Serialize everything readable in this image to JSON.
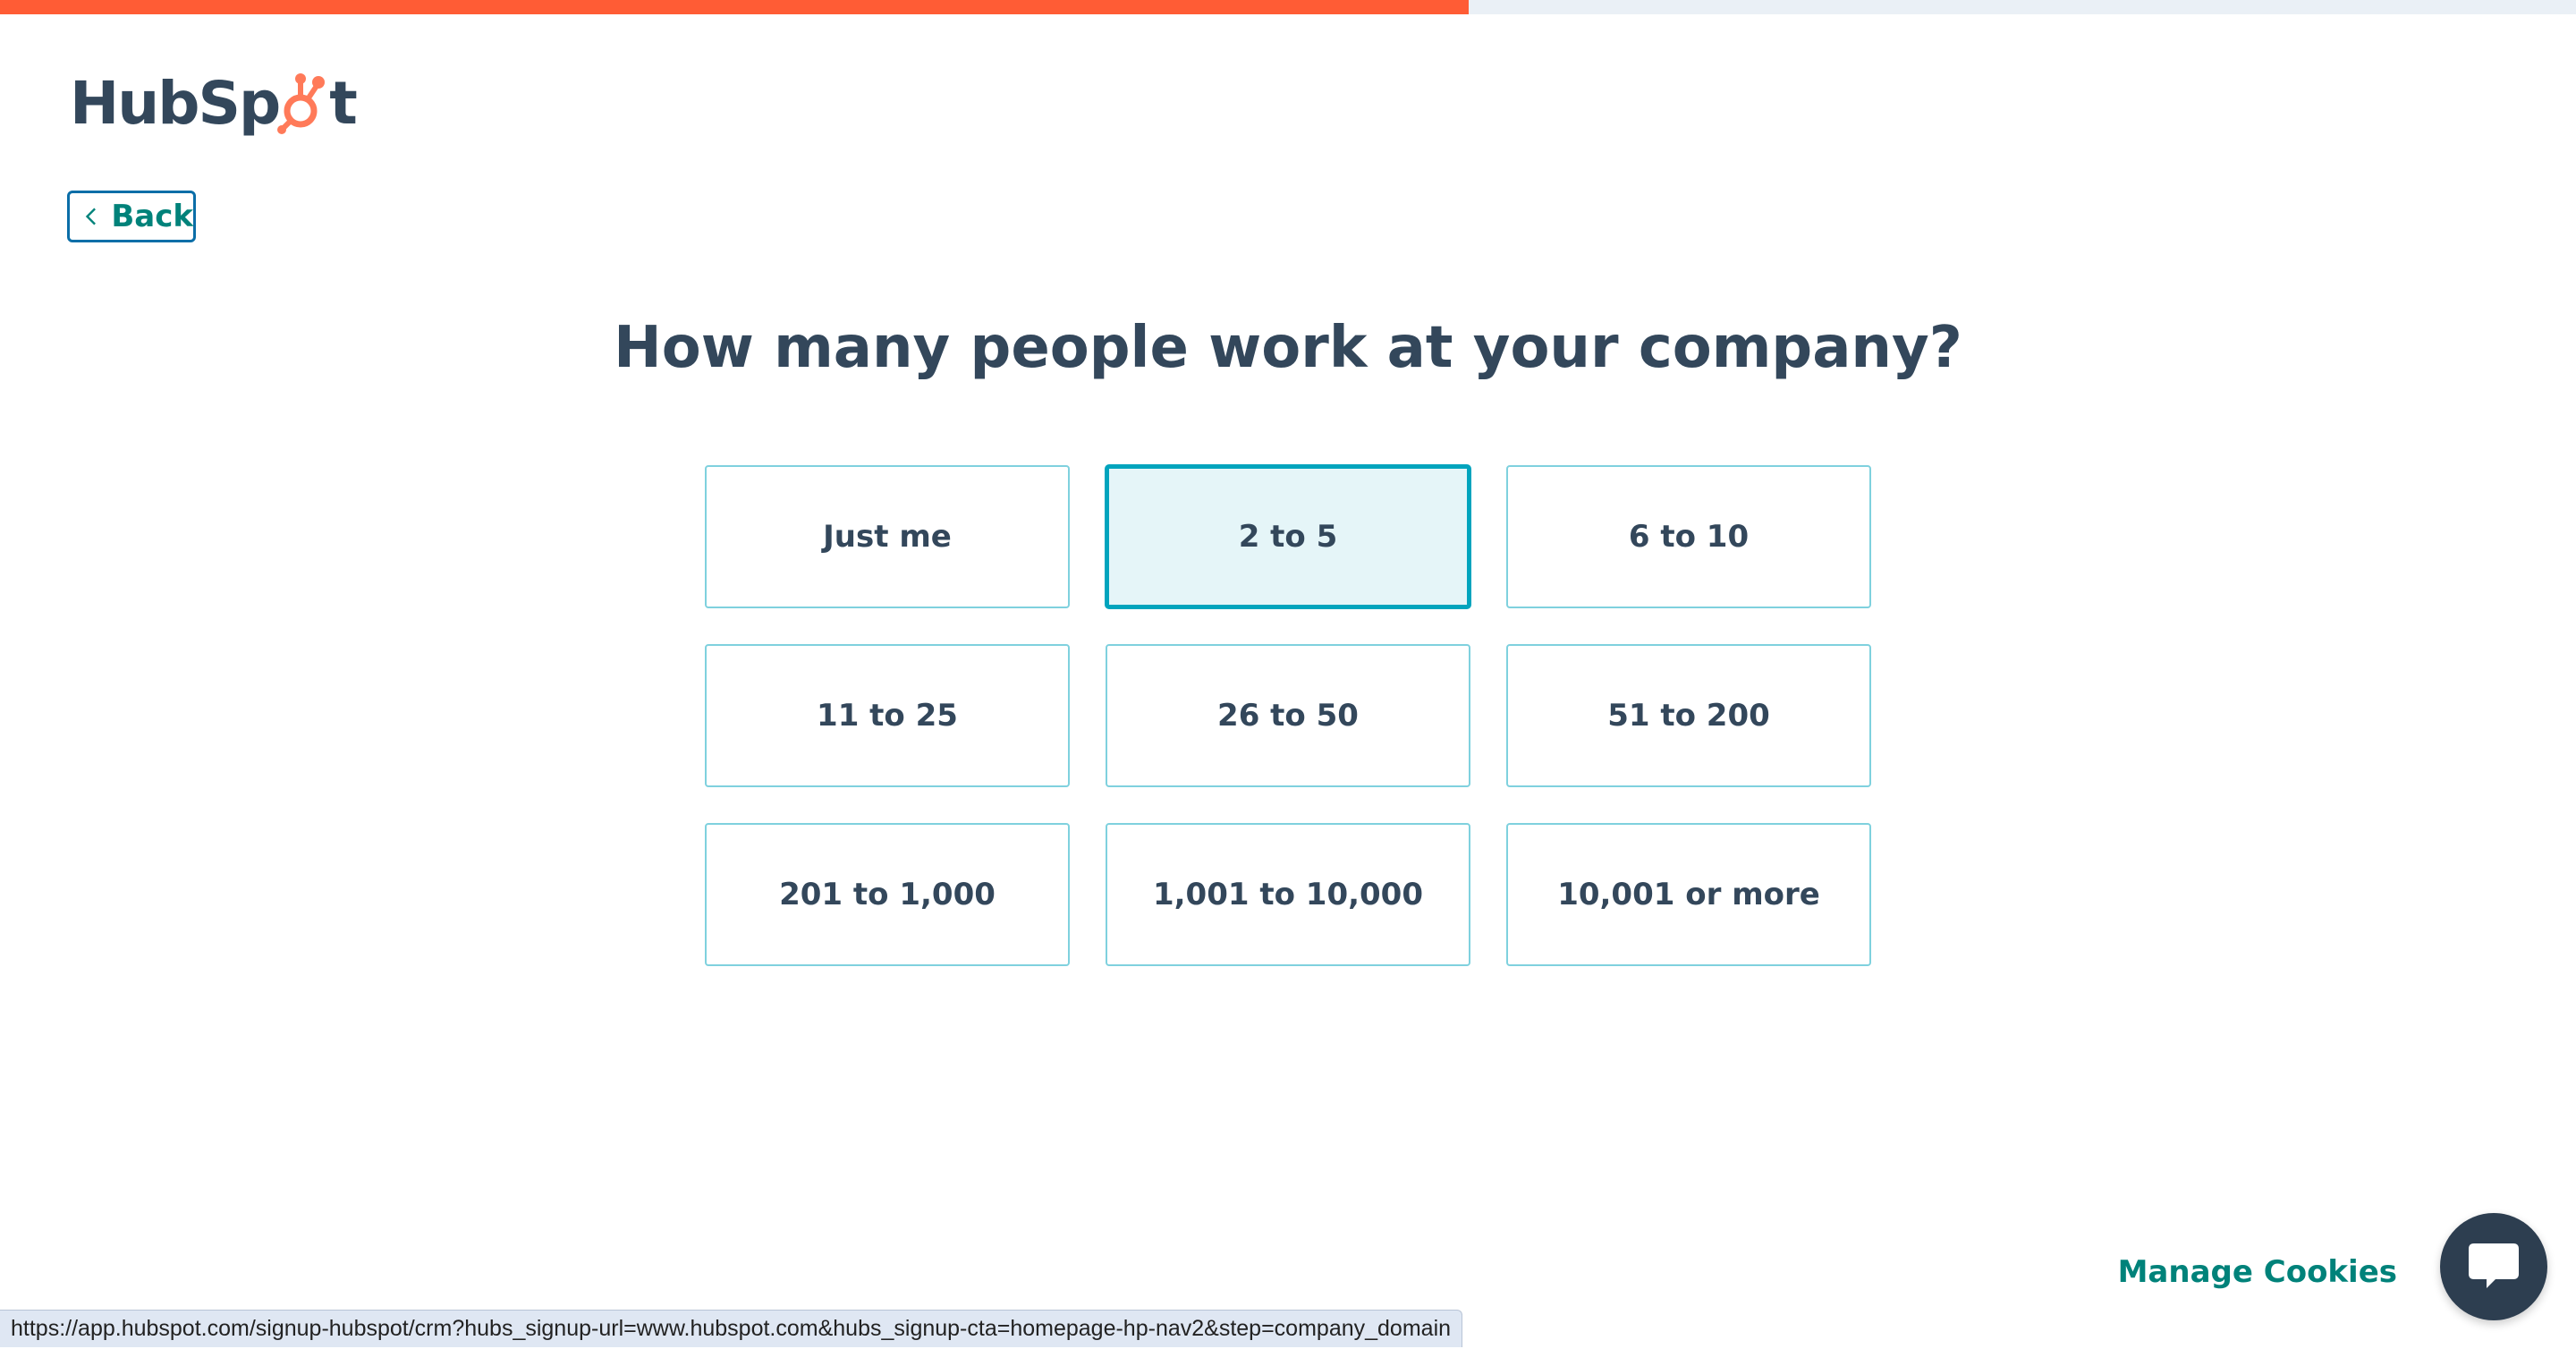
{
  "progress": {
    "fraction": 0.57,
    "color": "#ff5c35",
    "track_color": "#eaf0f6"
  },
  "logo": {
    "text_before": "HubSp",
    "text_after": "t",
    "accent_color": "#ff7a59",
    "icon": "sprocket-icon"
  },
  "back": {
    "label": "Back",
    "icon": "chevron-left-icon"
  },
  "question": "How many people work at your company?",
  "options": [
    {
      "label": "Just me",
      "selected": false
    },
    {
      "label": "2 to 5",
      "selected": true
    },
    {
      "label": "6 to 10",
      "selected": false
    },
    {
      "label": "11 to 25",
      "selected": false
    },
    {
      "label": "26 to 50",
      "selected": false
    },
    {
      "label": "51 to 200",
      "selected": false
    },
    {
      "label": "201 to 1,000",
      "selected": false
    },
    {
      "label": "1,001 to 10,000",
      "selected": false
    },
    {
      "label": "10,001 or more",
      "selected": false
    }
  ],
  "footer": {
    "manage_cookies": "Manage Cookies",
    "chat_icon": "chat-bubble-icon"
  },
  "status_bar": {
    "url": "https://app.hubspot.com/signup-hubspot/crm?hubs_signup-url=www.hubspot.com&hubs_signup-cta=homepage-hp-nav2&step=company_domain"
  },
  "colors": {
    "accent_teal": "#00827a",
    "selected_border": "#00a4bd",
    "selected_bg": "#e5f5f8",
    "text_dark": "#33475b"
  }
}
